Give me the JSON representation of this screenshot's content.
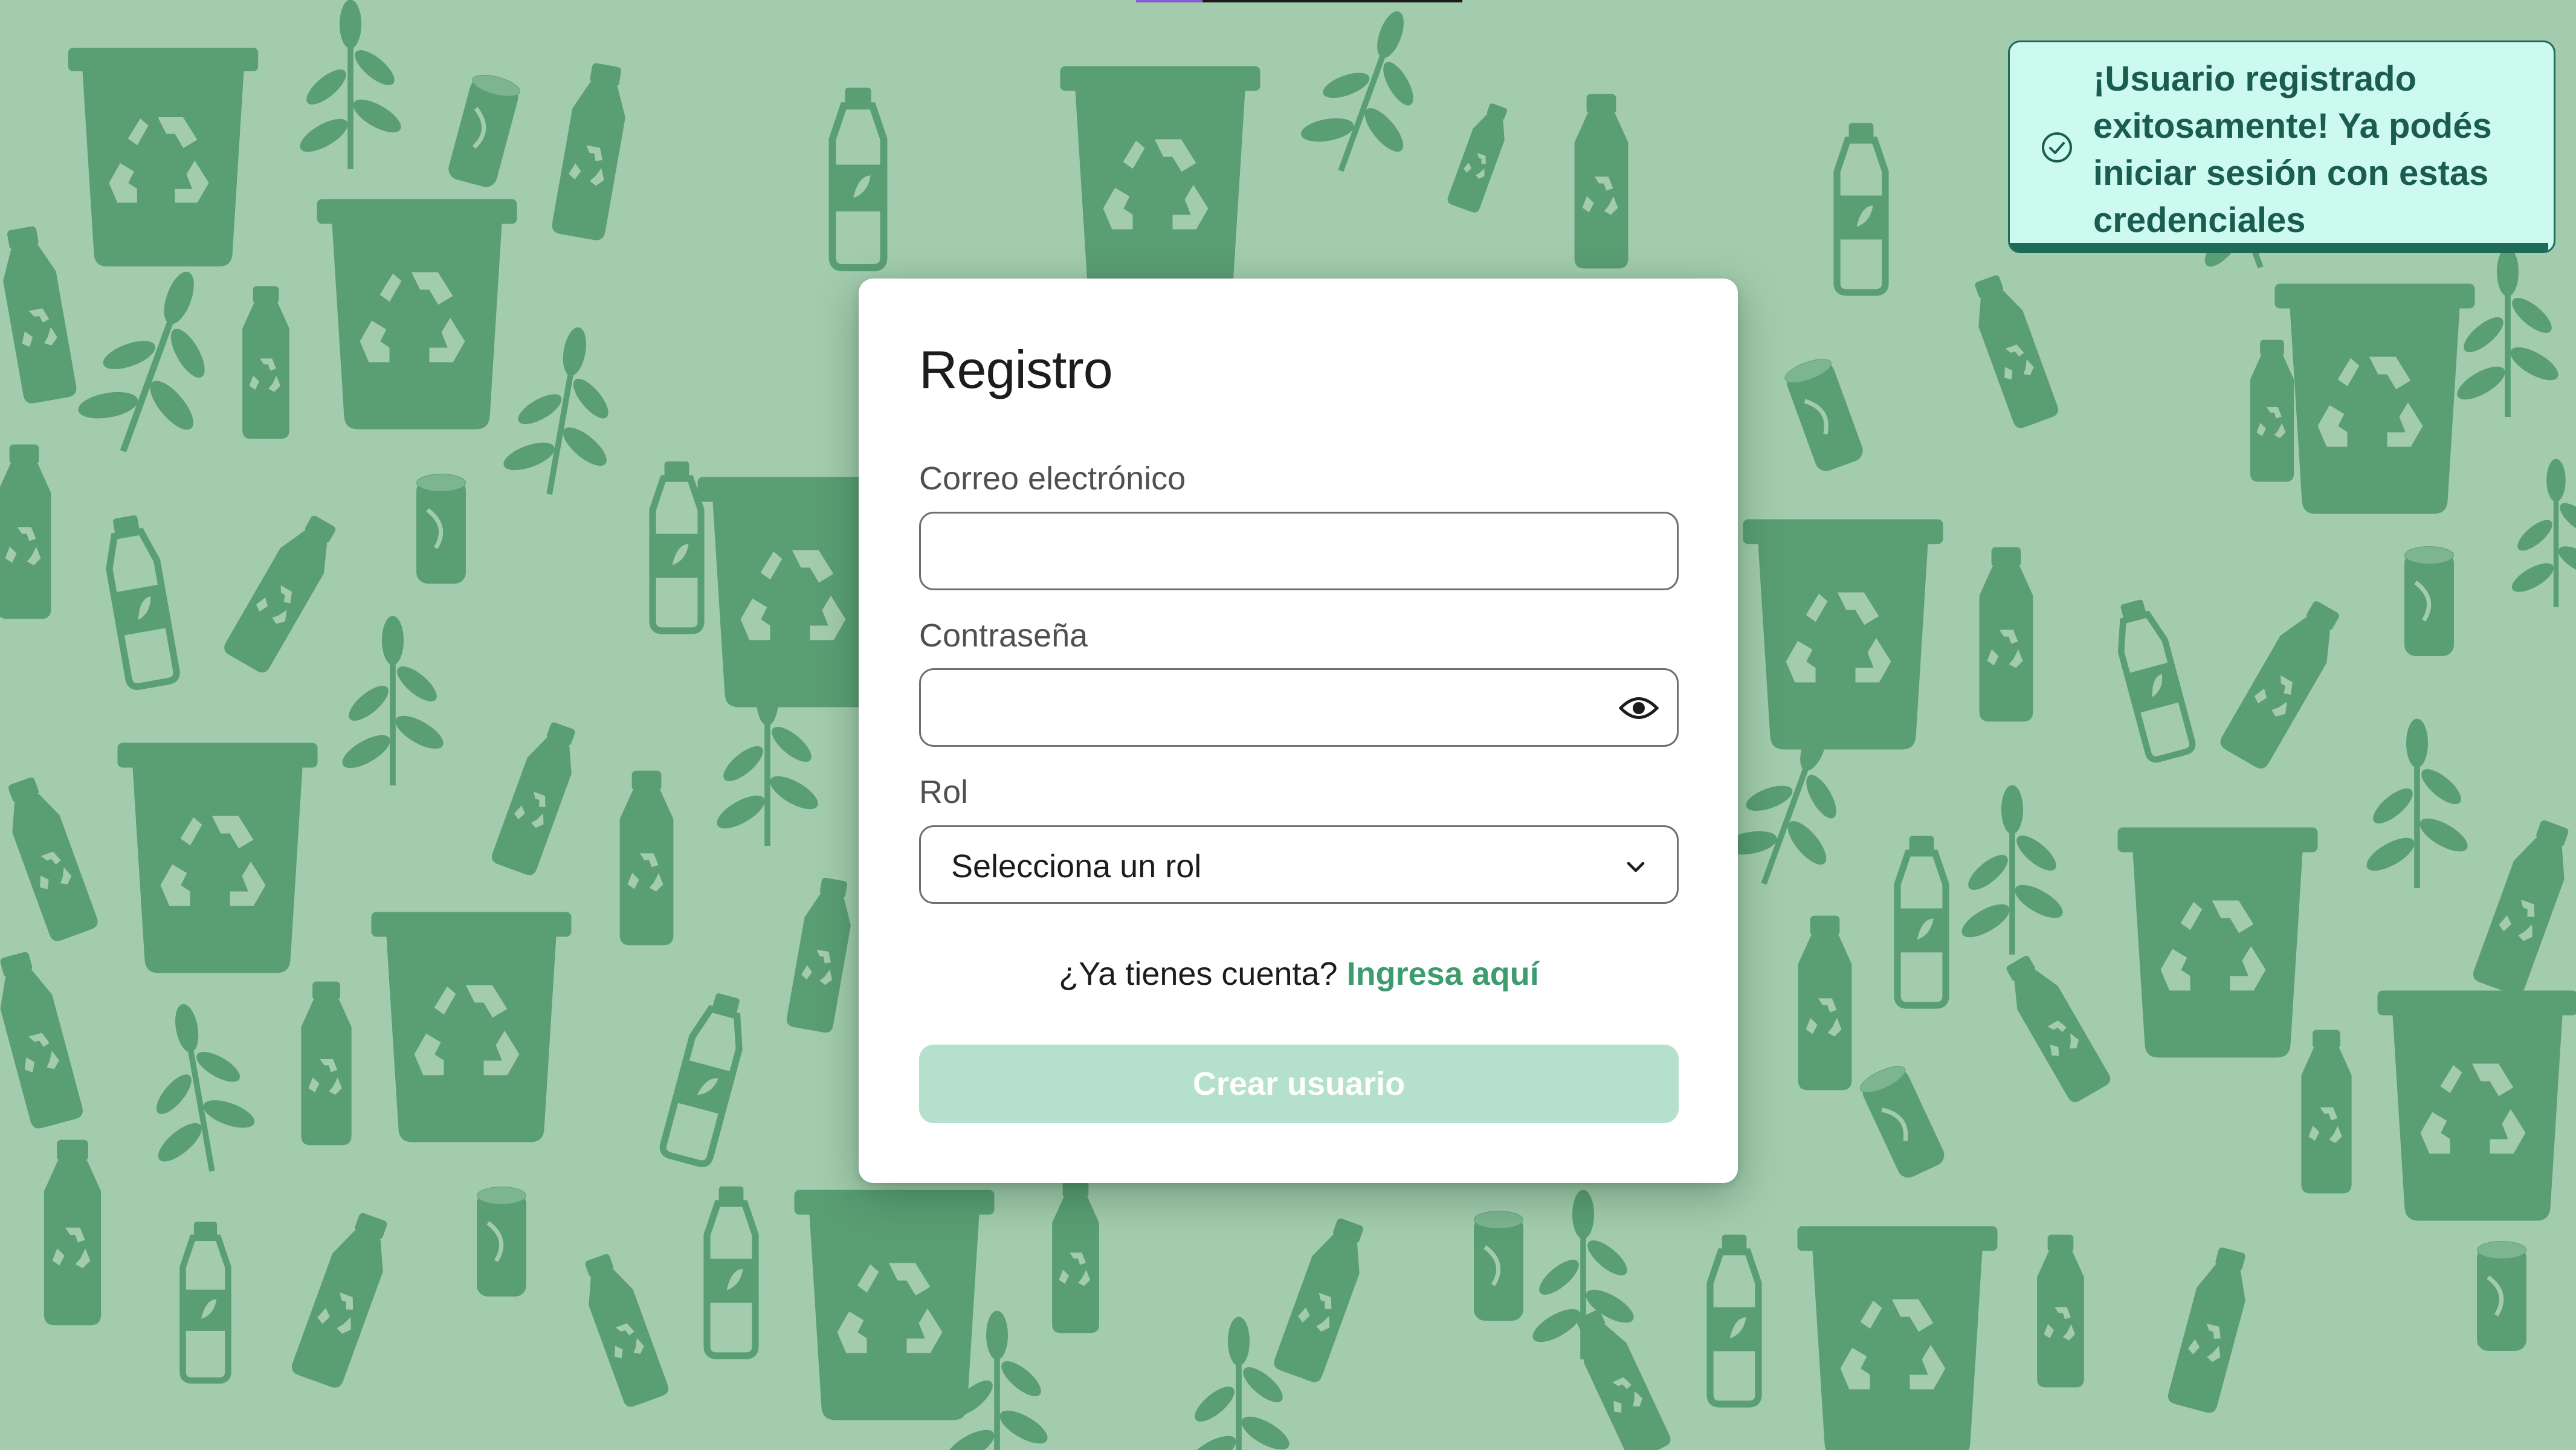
{
  "colors": {
    "background": "#a3ccae",
    "pattern": "#5a9e74",
    "accent": "#3d9c6e",
    "button_disabled": "#b4e0cd",
    "toast_bg": "#cdfaef",
    "toast_text": "#1a5c4f"
  },
  "register_form": {
    "title": "Registro",
    "email_label": "Correo electrónico",
    "email_value": "",
    "password_label": "Contraseña",
    "password_value": "",
    "password_toggle_icon": "eye-icon",
    "role_label": "Rol",
    "role_selected": "Selecciona un rol",
    "role_dropdown_icon": "chevron-down-icon",
    "login_prompt": "¿Ya tienes cuenta?",
    "login_link": "Ingresa aquí",
    "submit_label": "Crear usuario"
  },
  "toast": {
    "icon": "check-circle-icon",
    "message": "¡Usuario registrado exitosamente! Ya podés iniciar sesión con estas credenciales",
    "progress": 0.99
  }
}
